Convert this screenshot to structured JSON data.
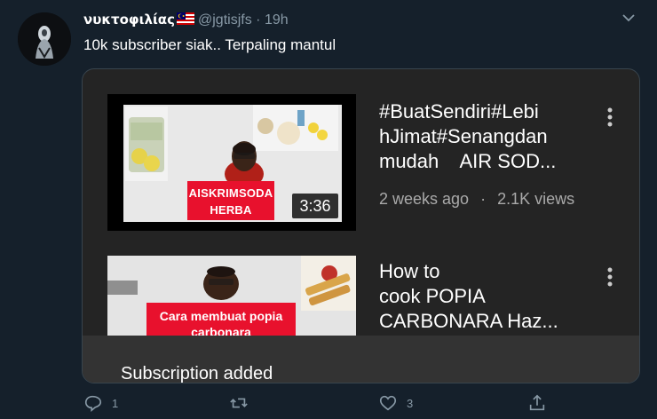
{
  "tweet": {
    "display_name": "νυκτοφιλίας",
    "handle": "@jgtisjfs",
    "separator": "·",
    "time": "19h",
    "text": "10k subscriber siak.. Terpaling mantul",
    "flag_icon": "malaysia-flag-icon"
  },
  "embed": {
    "videos": [
      {
        "title_line1": "#BuatSendiri#Lebi",
        "title_line2": "hJimat#Senangdan",
        "title_line3": "mudah    AIR SOD...",
        "thumb_caption_line1": "AISKRIMSODA",
        "thumb_caption_line2": "HERBA",
        "duration": "3:36",
        "age": "2 weeks ago",
        "meta_sep": "·",
        "views": "2.1K views"
      },
      {
        "title_line1": "How to",
        "title_line2": "cook POPIA",
        "title_line3": "CARBONARA Haz...",
        "thumb_caption_line1": "Cara membuat popia",
        "thumb_caption_line2": "carbonara"
      }
    ],
    "toast": "Subscription added"
  },
  "actions": {
    "reply_count": "1",
    "retweet_count": "",
    "like_count": "3"
  },
  "colors": {
    "background": "#15202b",
    "secondary_text": "#8899a6",
    "youtube_red": "#e8112d"
  }
}
